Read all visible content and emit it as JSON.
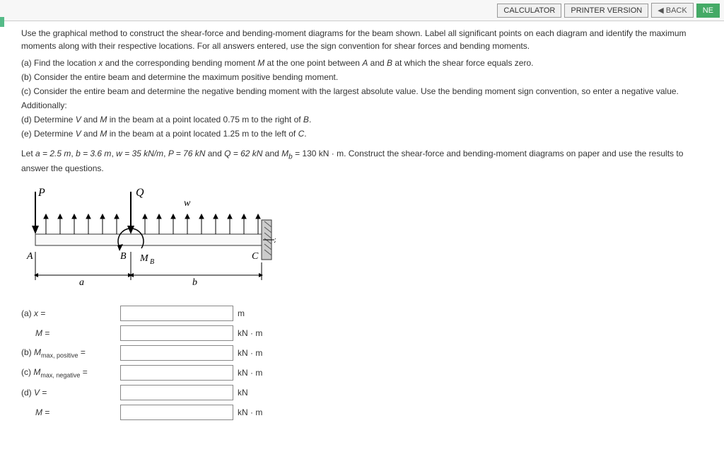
{
  "toolbar": {
    "calculator": "CALCULATOR",
    "printer": "PRINTER VERSION",
    "back": "◀ BACK",
    "next": "NE"
  },
  "intro": "Use the graphical method to construct the shear-force and bending-moment diagrams for the beam shown. Label all significant points on each diagram and identify the maximum moments along with their respective locations. For all answers entered, use the sign convention for shear forces and bending moments.",
  "parts": {
    "a_pre": "(a) Find the location ",
    "a_mid1": " and the corresponding bending moment ",
    "a_post": " at the one point between ",
    "a_tail": " at which the shear force equals zero.",
    "a_x": "x",
    "a_M": "M",
    "a_A": "A",
    "a_and": " and ",
    "a_B": "B",
    "b": "(b) Consider the entire beam and determine the maximum positive bending moment.",
    "c": "(c) Consider the entire beam and determine the negative bending moment with the largest absolute value.  Use the bending moment sign convention, so enter a negative value.",
    "add": "Additionally:",
    "d_pre": "(d)  Determine ",
    "d_mid": " in the beam at a point located ",
    "d_dist": "0.75 m",
    "d_post": " to the right of ",
    "d_ref": "B",
    "e_pre": "(e)  Determine ",
    "e_dist": "1.25 m",
    "e_post": " to the left of ",
    "e_ref": "C",
    "V": "V",
    "and": " and ",
    "M": "M",
    "period": "."
  },
  "given": {
    "pre": "Let ",
    "a_eq": "a = 2.5 m",
    "b_eq": "b = 3.6 m",
    "w_eq": "w = 35 kN/m",
    "P_eq": "P = 76 kN",
    "Q_eq": "Q = 62 kN",
    "Mb_eq": "M",
    "Mb_sub": "b",
    "Mb_val": " = 130 kN · m",
    "tail": ". Construct the shear-force and bending-moment diagrams on paper and use the results to answer the questions.",
    "sep": ", ",
    "and": " and "
  },
  "diagram": {
    "P": "P",
    "Q": "Q",
    "w": "w",
    "x": "x",
    "A": "A",
    "B": "B",
    "C": "C",
    "MB": "M",
    "MBsub": "B",
    "a": "a",
    "b": "b"
  },
  "answers": [
    {
      "label_pre": "(a) ",
      "label_it": "x",
      "label_post": " =",
      "unit": "m"
    },
    {
      "label_pre": "      ",
      "label_it": "M",
      "label_post": " =",
      "unit": "kN · m"
    },
    {
      "label_pre": "(b) ",
      "label_it": "M",
      "label_sub": "max, positive",
      "label_post": " =",
      "unit": "kN · m"
    },
    {
      "label_pre": "(c) ",
      "label_it": "M",
      "label_sub": "max, negative",
      "label_post": " =",
      "unit": "kN · m"
    },
    {
      "label_pre": "(d) ",
      "label_it": "V",
      "label_post": " =",
      "unit": "kN"
    },
    {
      "label_pre": "      ",
      "label_it": "M",
      "label_post": " =",
      "unit": "kN · m"
    }
  ]
}
